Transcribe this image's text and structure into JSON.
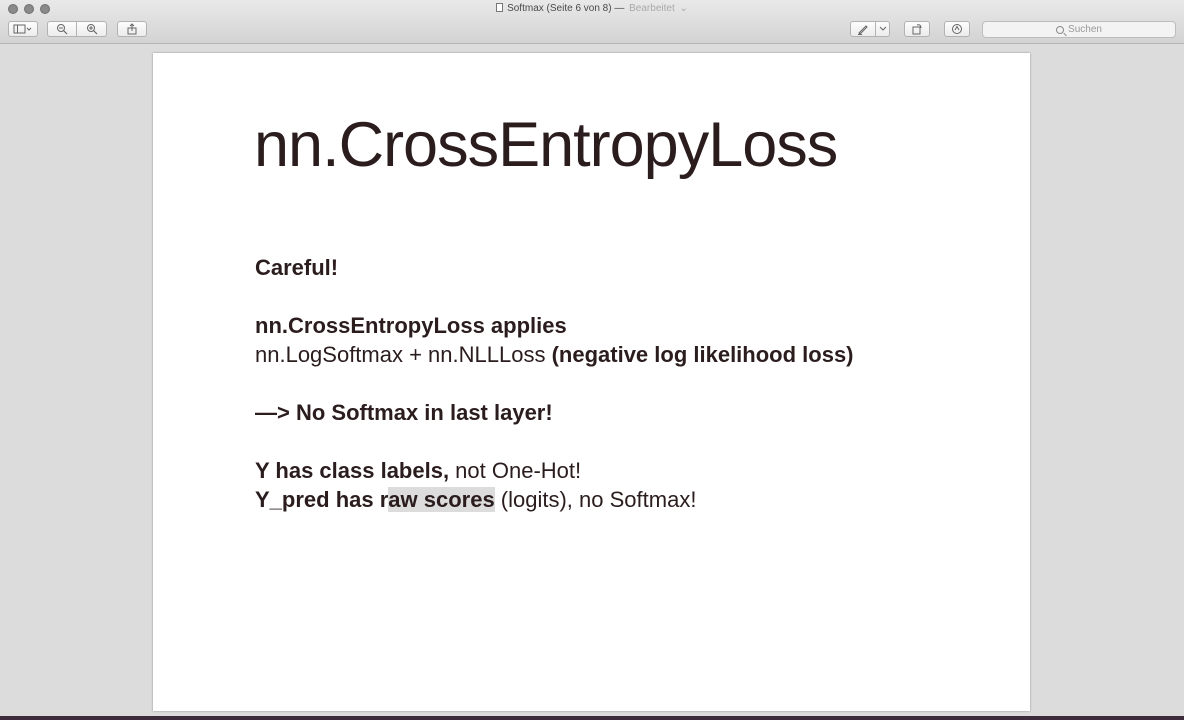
{
  "window": {
    "title": "Softmax (Seite 6 von 8)",
    "title_sep": "—",
    "edited": "Bearbeitet"
  },
  "toolbar": {
    "sidebar_icon": "sidebar-icon",
    "zoom_out_icon": "zoom-out-icon",
    "zoom_in_icon": "zoom-in-icon",
    "share_icon": "share-icon",
    "markup_icon": "pen-icon",
    "rotate_icon": "rotate-icon",
    "annotate_icon": "annotate-icon",
    "search_placeholder": "Suchen"
  },
  "slide": {
    "title": "nn.CrossEntropyLoss",
    "careful": "Careful!",
    "applies_line": "nn.CrossEntropyLoss applies",
    "formula_a": "nn.LogSoftmax + nn.NLLLoss",
    "formula_b": " (negative log likelihood loss)",
    "arrow_line": "—> No Softmax in last layer!",
    "y_line_a": "Y has class labels, ",
    "y_line_b": "not One-Hot!",
    "ypred_a": "Y_pred has r",
    "ypred_hl": "aw scores",
    "ypred_b": " (logits), ",
    "ypred_c": "no Softmax!"
  }
}
